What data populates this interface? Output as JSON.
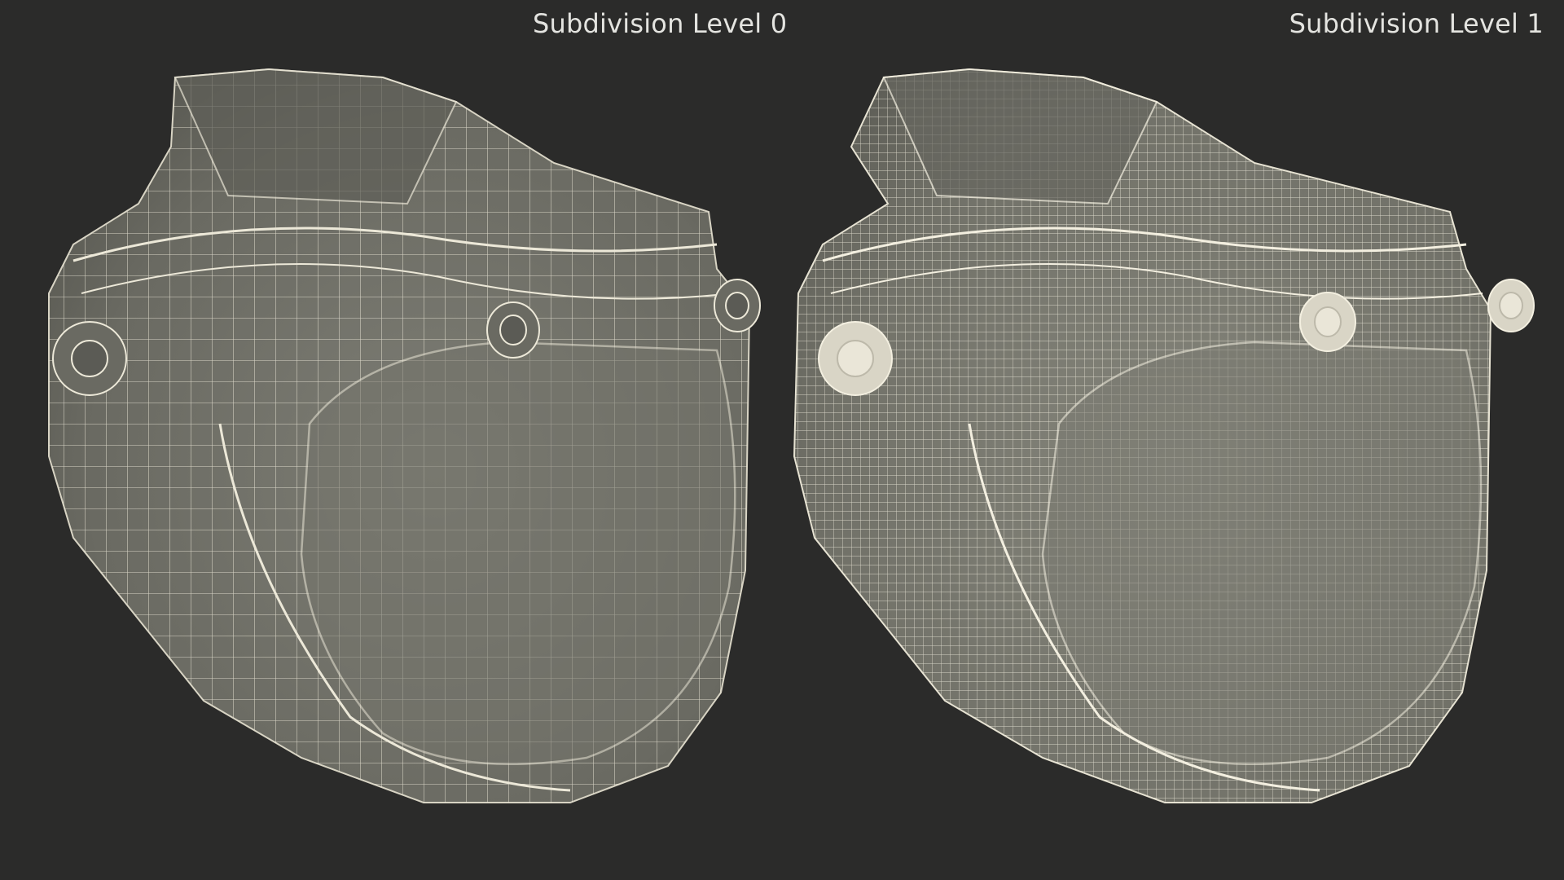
{
  "scene": {
    "background_color": "#2b2b2a",
    "label_color": "#e4e4e0",
    "panels": [
      {
        "label": "Subdivision Level 0",
        "shading_color": "#6f6f67",
        "wire_color": "#ece8d8",
        "wire_density": "coarse"
      },
      {
        "label": "Subdivision Level 1",
        "shading_color": "#77776e",
        "wire_color": "#f3efe0",
        "wire_density": "fine"
      }
    ]
  }
}
